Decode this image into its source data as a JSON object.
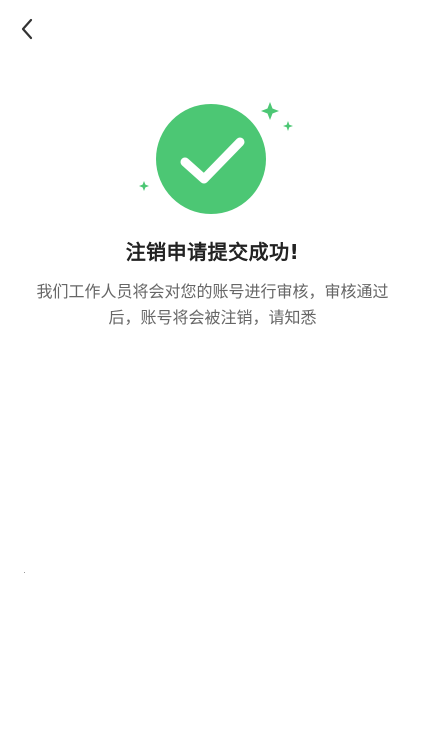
{
  "nav": {
    "back_icon": "chevron-left-icon"
  },
  "result": {
    "icon": "check-circle-icon",
    "accent_color": "#4CC774",
    "title": "注销申请提交成功!",
    "description": "我们工作人员将会对您的账号进行审核，审核通过后，账号将会被注销，请知悉"
  }
}
